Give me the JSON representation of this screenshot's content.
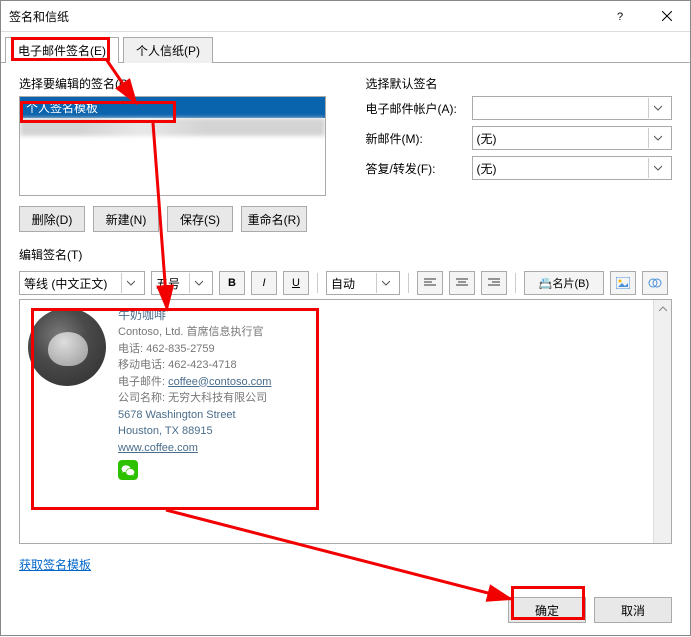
{
  "title": "签名和信纸",
  "tabs": {
    "email_signature": "电子邮件签名(E)",
    "personal_stationery": "个人信纸(P)"
  },
  "edit_section": {
    "heading": "选择要编辑的签名(C)",
    "items": [
      "个人签名模板",
      "███████"
    ],
    "buttons": {
      "delete": "删除(D)",
      "new": "新建(N)",
      "save": "保存(S)",
      "rename": "重命名(R)"
    }
  },
  "default_section": {
    "heading": "选择默认签名",
    "account_label": "电子邮件帐户(A):",
    "account_value": "",
    "new_label": "新邮件(M):",
    "new_value": "(无)",
    "reply_label": "答复/转发(F):",
    "reply_value": "(无)"
  },
  "editor": {
    "heading": "编辑签名(T)",
    "font": "等线 (中文正文)",
    "size": "五号",
    "auto": "自动",
    "business_card": "名片(B)"
  },
  "signature_preview": {
    "name": "牛奶咖啡",
    "title_line": "Contoso, Ltd. 首席信息执行官",
    "phone_label": "电话: ",
    "phone": "462-835-2759",
    "mobile_label": "移动电话: ",
    "mobile": "462-423-4718",
    "email_label": "电子邮件: ",
    "email": "coffee@contoso.com",
    "company_label": "公司名称: ",
    "company": "无穷大科技有限公司",
    "addr1": "5678 Washington Street",
    "addr2": "Houston, TX 88915",
    "website": "www.coffee.com"
  },
  "get_templates": "获取签名模板",
  "footer": {
    "ok": "确定",
    "cancel": "取消"
  }
}
